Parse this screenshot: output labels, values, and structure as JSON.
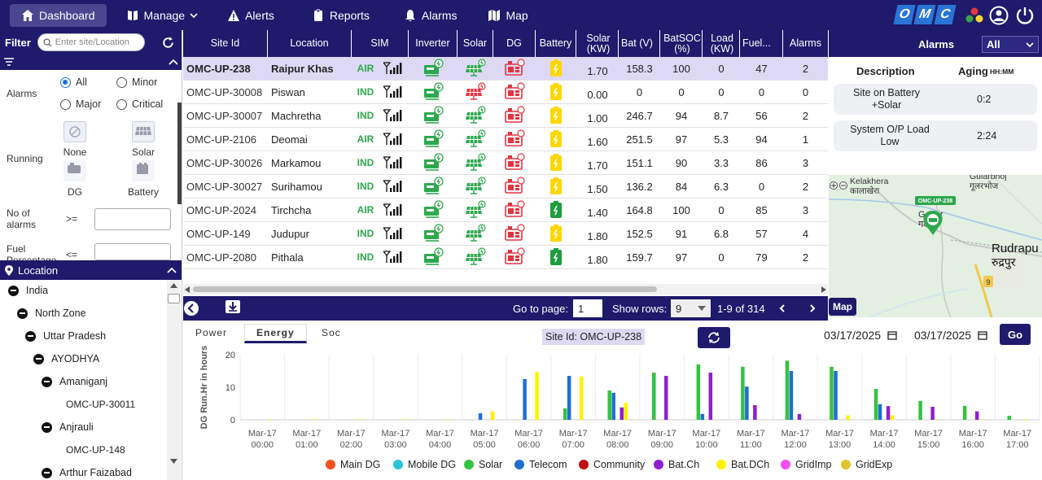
{
  "nav": {
    "items": [
      {
        "label": "Dashboard",
        "icon": "home-icon"
      },
      {
        "label": "Manage",
        "icon": "book-icon"
      },
      {
        "label": "Alerts",
        "icon": "warning-icon"
      },
      {
        "label": "Reports",
        "icon": "clipboard-icon"
      },
      {
        "label": "Alarms",
        "icon": "bell-icon"
      },
      {
        "label": "Map",
        "icon": "map-icon"
      }
    ],
    "brand": [
      "O",
      "M",
      "C"
    ]
  },
  "filter": {
    "title": "Filter",
    "search_placeholder": "Enter site/Location",
    "alarms_label": "Alarms",
    "alarm_options": [
      "All",
      "Minor",
      "Major",
      "Critical"
    ],
    "alarm_selected": "All",
    "running_label": "Running",
    "running_options": [
      "None",
      "Solar",
      "DG",
      "Battery"
    ],
    "no_alarms_label": "No of alarms",
    "no_alarms_op": ">=",
    "fuel_label": "Fuel Percentage",
    "fuel_op": "<="
  },
  "location": {
    "title": "Location",
    "tree": [
      {
        "label": "India",
        "level": 0,
        "type": "node"
      },
      {
        "label": "North Zone",
        "level": 1,
        "type": "node"
      },
      {
        "label": "Uttar Pradesh",
        "level": 2,
        "type": "node"
      },
      {
        "label": "AYODHYA",
        "level": 3,
        "type": "node"
      },
      {
        "label": "Amaniganj",
        "level": 4,
        "type": "node"
      },
      {
        "label": "OMC-UP-30011",
        "level": 5,
        "type": "leaf"
      },
      {
        "label": "Anjrauli",
        "level": 4,
        "type": "node"
      },
      {
        "label": "OMC-UP-148",
        "level": 5,
        "type": "leaf"
      },
      {
        "label": "Arthur Faizabad",
        "level": 4,
        "type": "node"
      }
    ]
  },
  "table": {
    "columns": [
      "Site Id",
      "Location",
      "SIM",
      "Inverter",
      "Solar",
      "DG",
      "Battery",
      "Solar (KW)",
      "Bat (V)",
      "BatSOC (%)",
      "Load (KW)",
      "Fuel...",
      "Alarms"
    ],
    "rows": [
      {
        "site": "OMC-UP-238",
        "loc": "Raipur Khas",
        "sim": "AIR",
        "solar_state": "green",
        "bat_state": "yellow",
        "solar_kw": "1.70",
        "bat_v": "158.3",
        "soc": "100",
        "load": "0",
        "fuel": "47",
        "alarms": "2",
        "selected": true
      },
      {
        "site": "OMC-UP-30008",
        "loc": "Piswan",
        "sim": "IND",
        "solar_state": "red",
        "bat_state": "yellow",
        "solar_kw": "0.00",
        "bat_v": "0",
        "soc": "0",
        "load": "0",
        "fuel": "0",
        "alarms": "0",
        "selected": false
      },
      {
        "site": "OMC-UP-30007",
        "loc": "Machretha",
        "sim": "IND",
        "solar_state": "green",
        "bat_state": "yellow",
        "solar_kw": "1.00",
        "bat_v": "246.7",
        "soc": "94",
        "load": "8.7",
        "fuel": "56",
        "alarms": "2",
        "selected": false
      },
      {
        "site": "OMC-UP-2106",
        "loc": "Deomai",
        "sim": "AIR",
        "solar_state": "green",
        "bat_state": "yellow",
        "solar_kw": "1.60",
        "bat_v": "251.5",
        "soc": "97",
        "load": "5.3",
        "fuel": "94",
        "alarms": "1",
        "selected": false
      },
      {
        "site": "OMC-UP-30026",
        "loc": "Markamou",
        "sim": "IND",
        "solar_state": "green",
        "bat_state": "yellow",
        "solar_kw": "1.70",
        "bat_v": "151.1",
        "soc": "90",
        "load": "3.3",
        "fuel": "86",
        "alarms": "3",
        "selected": false
      },
      {
        "site": "OMC-UP-30027",
        "loc": "Surihamou",
        "sim": "IND",
        "solar_state": "green",
        "bat_state": "yellow",
        "solar_kw": "1.50",
        "bat_v": "136.2",
        "soc": "84",
        "load": "6.3",
        "fuel": "0",
        "alarms": "2",
        "selected": false
      },
      {
        "site": "OMC-UP-2024",
        "loc": "Tirchcha",
        "sim": "AIR",
        "solar_state": "green",
        "bat_state": "green",
        "solar_kw": "1.40",
        "bat_v": "164.8",
        "soc": "100",
        "load": "0",
        "fuel": "85",
        "alarms": "3",
        "selected": false
      },
      {
        "site": "OMC-UP-149",
        "loc": "Judupur",
        "sim": "IND",
        "solar_state": "green",
        "bat_state": "yellow",
        "solar_kw": "1.80",
        "bat_v": "152.5",
        "soc": "91",
        "load": "6.8",
        "fuel": "57",
        "alarms": "4",
        "selected": false
      },
      {
        "site": "OMC-UP-2080",
        "loc": "Pithala",
        "sim": "IND",
        "solar_state": "green",
        "bat_state": "green",
        "solar_kw": "1.80",
        "bat_v": "159.7",
        "soc": "97",
        "load": "0",
        "fuel": "79",
        "alarms": "2",
        "selected": false
      }
    ]
  },
  "pager": {
    "goto_label": "Go to page:",
    "page": "1",
    "rows_label": "Show rows:",
    "rows": "9",
    "range": "1-9 of 314"
  },
  "alarms": {
    "title": "Alarms",
    "filter": "All",
    "col_desc": "Description",
    "col_aging": "Aging",
    "aging_unit": "HH:MM",
    "items": [
      {
        "desc1": "Site on Battery",
        "desc2": "+Solar",
        "aging": "0:2"
      },
      {
        "desc1": "System O/P Load",
        "desc2": "Low",
        "aging": "2:24"
      }
    ]
  },
  "map": {
    "button": "Map",
    "labels": [
      "Kelakhera",
      "कालाखेरा",
      "Gularbhoj",
      "गूलरभोज",
      "Gadar",
      "गदर",
      "Rudrapu",
      "रुद्रपुर"
    ],
    "marker_label": "OMC-UP-238",
    "road_shield": "9"
  },
  "chart_tabs": [
    "Power",
    "Energy",
    "Soc"
  ],
  "chart_tab_active": "Energy",
  "chart_site": "Site Id: OMC-UP-238",
  "date_from": "03/17/2025",
  "date_to": "03/17/2025",
  "go_label": "Go",
  "colors": {
    "navy": "#1f1a6b",
    "green": "#2ea84e",
    "red": "#e5323e",
    "yellow": "#ffd600"
  },
  "chart_data": {
    "type": "bar",
    "ylabel": "DG Run.Hr in hours",
    "ylim": [
      0,
      20
    ],
    "yticks": [
      0,
      10,
      20
    ],
    "categories": [
      "Mar-17 00:00",
      "Mar-17 01:00",
      "Mar-17 02:00",
      "Mar-17 03:00",
      "Mar-17 04:00",
      "Mar-17 05:00",
      "Mar-17 06:00",
      "Mar-17 07:00",
      "Mar-17 08:00",
      "Mar-17 09:00",
      "Mar-17 10:00",
      "Mar-17 11:00",
      "Mar-17 12:00",
      "Mar-17 13:00",
      "Mar-17 14:00",
      "Mar-17 15:00",
      "Mar-17 16:00",
      "Mar-17 17:00"
    ],
    "series": [
      {
        "name": "Main DG",
        "color": "#f4511e",
        "values": [
          0,
          0,
          0,
          0,
          0,
          0,
          0,
          0,
          0,
          0,
          0,
          0,
          0,
          0,
          0,
          0,
          0,
          0
        ]
      },
      {
        "name": "Mobile DG",
        "color": "#26c6da",
        "values": [
          0,
          0,
          0,
          0,
          0,
          0,
          0,
          0,
          0,
          0,
          0,
          0,
          0,
          0,
          0,
          0,
          0,
          0
        ]
      },
      {
        "name": "Solar",
        "color": "#34c240",
        "values": [
          0,
          0,
          0,
          0,
          0,
          0,
          0,
          3.5,
          9,
          14.5,
          17,
          16.3,
          18.2,
          16.3,
          9.5,
          5.8,
          4.3,
          1.2
        ]
      },
      {
        "name": "Telecom",
        "color": "#1f6fd1",
        "values": [
          0,
          0,
          0,
          0,
          0,
          2,
          12.5,
          13.5,
          8.3,
          0,
          1.8,
          10.2,
          15,
          15,
          4.8,
          0,
          0,
          0
        ]
      },
      {
        "name": "Community",
        "color": "#c0100c",
        "values": [
          0,
          0,
          0,
          0,
          0,
          0,
          0,
          0,
          0,
          0,
          0,
          0,
          0,
          0,
          0,
          0,
          0,
          0
        ]
      },
      {
        "name": "Bat.Ch",
        "color": "#8e1fd1",
        "values": [
          0,
          0,
          0,
          0,
          0,
          0,
          0,
          0,
          3.8,
          13.5,
          14.5,
          4.5,
          1.8,
          0,
          4.2,
          4,
          2.6,
          0
        ]
      },
      {
        "name": "Bat.DCh",
        "color": "#fff200",
        "values": [
          0.2,
          0.2,
          0.2,
          0.2,
          0.2,
          2.6,
          14.7,
          13.3,
          5.2,
          0,
          0,
          0,
          0,
          1.4,
          1.4,
          0.2,
          0.2,
          0.2
        ]
      },
      {
        "name": "GridImp",
        "color": "#f04ff0",
        "values": [
          0,
          0,
          0,
          0,
          0,
          0,
          0,
          0,
          0,
          0,
          0,
          0,
          0,
          0,
          0,
          0,
          0,
          0
        ]
      },
      {
        "name": "GridExp",
        "color": "#e3c22b",
        "values": [
          0,
          0,
          0,
          0,
          0,
          0,
          0,
          0,
          0,
          0,
          0,
          0,
          0,
          0,
          0,
          0,
          0,
          0
        ]
      }
    ]
  }
}
